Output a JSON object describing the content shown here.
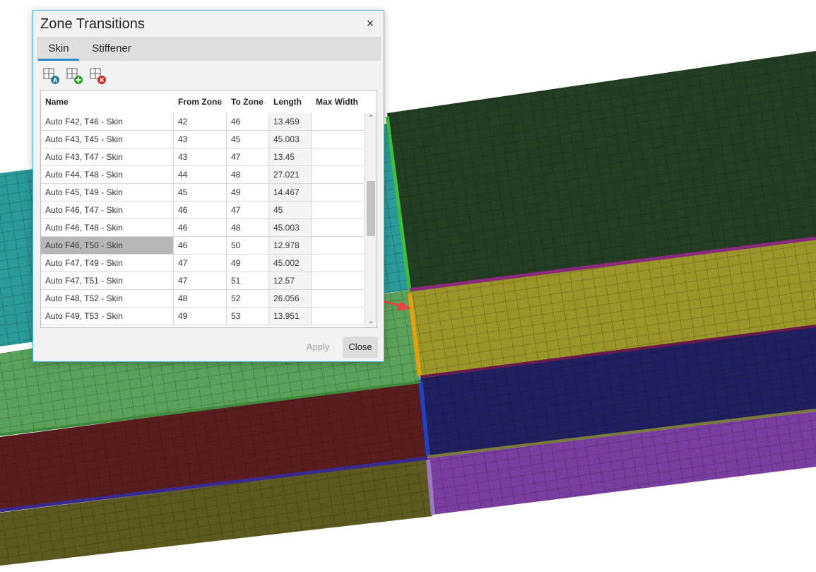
{
  "dialog": {
    "title": "Zone Transitions",
    "close_symbol": "×",
    "tabs": [
      {
        "label": "Skin",
        "active": true
      },
      {
        "label": "Stiffener",
        "active": false
      }
    ],
    "toolbar": [
      {
        "icon": "add-auto-transition-icon"
      },
      {
        "icon": "add-transition-icon"
      },
      {
        "icon": "delete-transition-icon"
      }
    ],
    "columns": [
      "Name",
      "From Zone",
      "To Zone",
      "Length",
      "Max Width"
    ],
    "rows": [
      {
        "name": "Auto F42, T46 - Skin",
        "from": "42",
        "to": "46",
        "length": "13.459",
        "max_width": ""
      },
      {
        "name": "Auto F43, T45 - Skin",
        "from": "43",
        "to": "45",
        "length": "45.003",
        "max_width": ""
      },
      {
        "name": "Auto F43, T47 - Skin",
        "from": "43",
        "to": "47",
        "length": "13.45",
        "max_width": ""
      },
      {
        "name": "Auto F44, T48 - Skin",
        "from": "44",
        "to": "48",
        "length": "27.021",
        "max_width": ""
      },
      {
        "name": "Auto F45, T49 - Skin",
        "from": "45",
        "to": "49",
        "length": "14.467",
        "max_width": ""
      },
      {
        "name": "Auto F46, T47 - Skin",
        "from": "46",
        "to": "47",
        "length": "45",
        "max_width": ""
      },
      {
        "name": "Auto F46, T48 - Skin",
        "from": "46",
        "to": "48",
        "length": "45.003",
        "max_width": ""
      },
      {
        "name": "Auto F46, T50 - Skin",
        "from": "46",
        "to": "50",
        "length": "12.978",
        "max_width": "",
        "selected": true
      },
      {
        "name": "Auto F47, T49 - Skin",
        "from": "47",
        "to": "49",
        "length": "45.002",
        "max_width": ""
      },
      {
        "name": "Auto F47, T51 - Skin",
        "from": "47",
        "to": "51",
        "length": "12.57",
        "max_width": ""
      },
      {
        "name": "Auto F48, T52 - Skin",
        "from": "48",
        "to": "52",
        "length": "26.056",
        "max_width": ""
      },
      {
        "name": "Auto F49, T53 - Skin",
        "from": "49",
        "to": "53",
        "length": "13.951",
        "max_width": ""
      }
    ],
    "scroll_up": "⌃",
    "scroll_down": "⌄",
    "buttons": {
      "apply": "Apply",
      "close": "Close"
    }
  },
  "viewport": {
    "colors": {
      "teal": "#2a9a9a",
      "dark_green": "#223d22",
      "yellow": "#9a9628",
      "light_green": "#5aa25a",
      "dark_red": "#5a1d1d",
      "navy": "#202060",
      "olive": "#5c5a1e",
      "purple": "#7a3ea0",
      "arrow": "#e8453c"
    }
  }
}
